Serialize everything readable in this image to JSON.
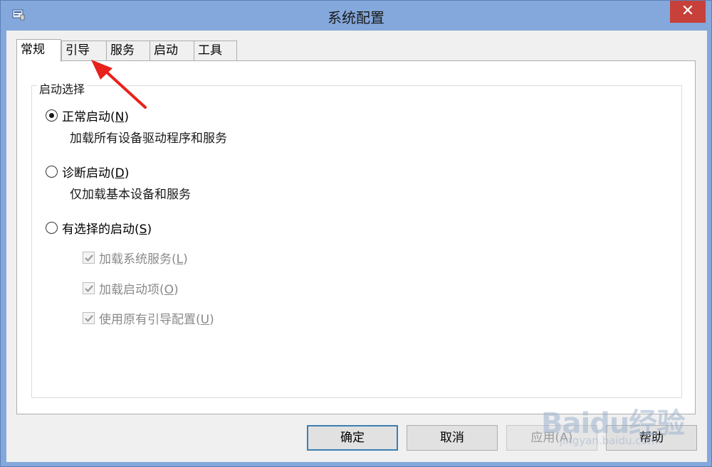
{
  "window": {
    "title": "系统配置",
    "close_glyph": "✕"
  },
  "tabs": [
    {
      "label": "常规",
      "active": true
    },
    {
      "label": "引导",
      "active": false
    },
    {
      "label": "服务",
      "active": false
    },
    {
      "label": "启动",
      "active": false
    },
    {
      "label": "工具",
      "active": false
    }
  ],
  "startup": {
    "group_label": "启动选择",
    "normal": {
      "label": "正常启动(",
      "key": "N",
      "suffix": ")",
      "desc": "加载所有设备驱动程序和服务",
      "selected": true
    },
    "diagnostic": {
      "label": "诊断启动(",
      "key": "D",
      "suffix": ")",
      "desc": "仅加载基本设备和服务",
      "selected": false
    },
    "selective": {
      "label": "有选择的启动(",
      "key": "S",
      "suffix": ")",
      "selected": false
    },
    "options": [
      {
        "label": "加载系统服务(",
        "key": "L",
        "suffix": ")",
        "checked": true,
        "enabled": false
      },
      {
        "label": "加载启动项(",
        "key": "O",
        "suffix": ")",
        "checked": true,
        "enabled": false
      },
      {
        "label": "使用原有引导配置(",
        "key": "U",
        "suffix": ")",
        "checked": true,
        "enabled": false
      }
    ]
  },
  "buttons": {
    "ok": "确定",
    "cancel": "取消",
    "apply": "应用(A)",
    "help": "帮助"
  },
  "watermark": {
    "logo": "Baidu经验",
    "url": "jingyan.baidu.com"
  },
  "colors": {
    "title_bg": "#84a8dc",
    "close_bg": "#c7403a",
    "arrow": "#e8211c"
  }
}
